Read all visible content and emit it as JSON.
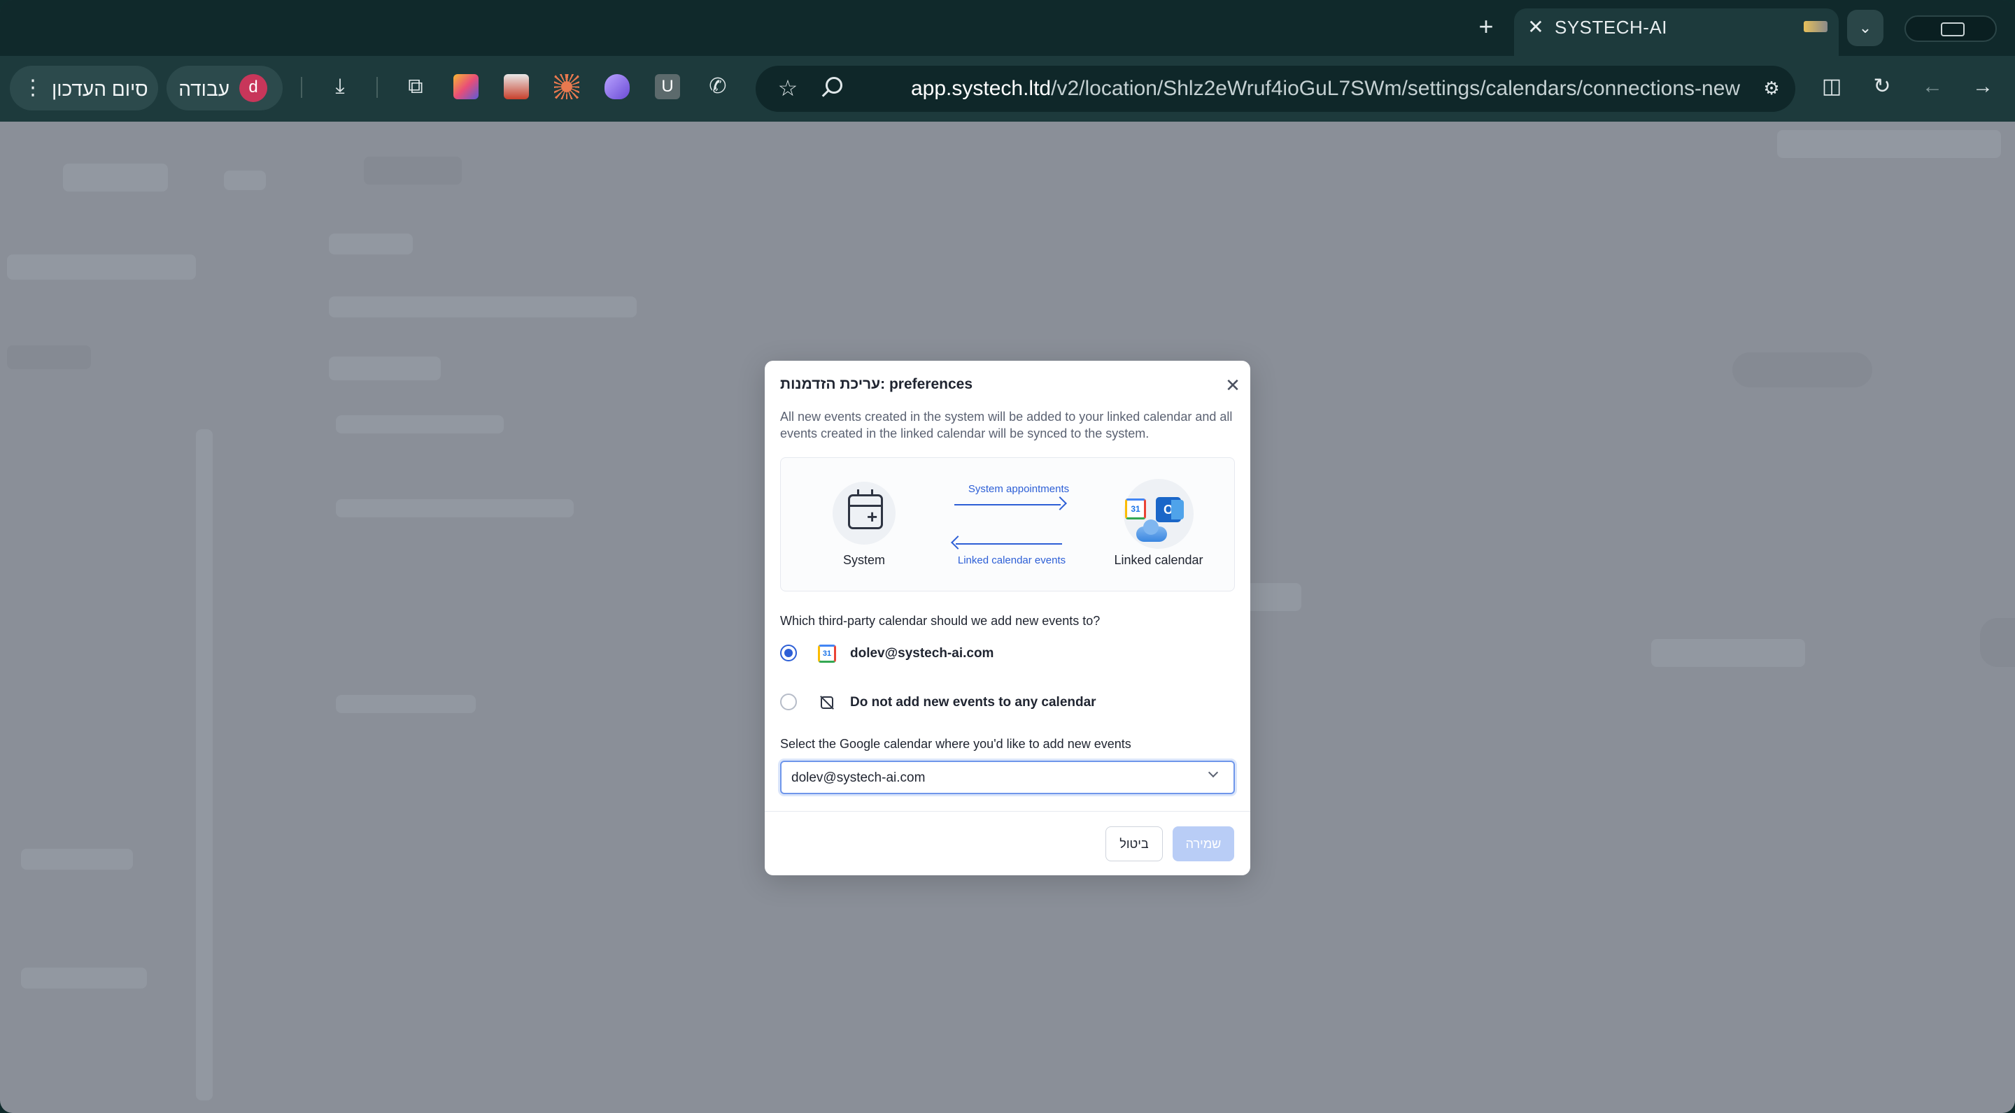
{
  "browser": {
    "tab_title": "SYSTECH-AI",
    "address_host": "app.systech.ltd",
    "address_path": "/v2/location/Shlz2eWruf4ioGuL7SWm/settings/calendars/connections-new",
    "update_button": "סיום העדכון",
    "work_profile": "עבודה",
    "profile_initial": "d"
  },
  "modal": {
    "title": "עריכת הזדמנות: preferences",
    "description": "All new events created in the system will be added to your linked calendar and all events created in the linked calendar will be synced to the system.",
    "diagram": {
      "system_label": "System",
      "linked_label": "Linked calendar",
      "arrow_top_label": "System appointments",
      "arrow_bottom_label": "Linked calendar events"
    },
    "question": "Which third-party calendar should we add new events to?",
    "options": [
      {
        "label": "dolev@systech-ai.com",
        "selected": true
      },
      {
        "label": "Do not add new events to any calendar",
        "selected": false
      }
    ],
    "select_label": "Select the Google calendar where you'd like to add new events",
    "select_value": "dolev@systech-ai.com",
    "cancel_label": "ביטול",
    "save_label": "שמירה"
  }
}
